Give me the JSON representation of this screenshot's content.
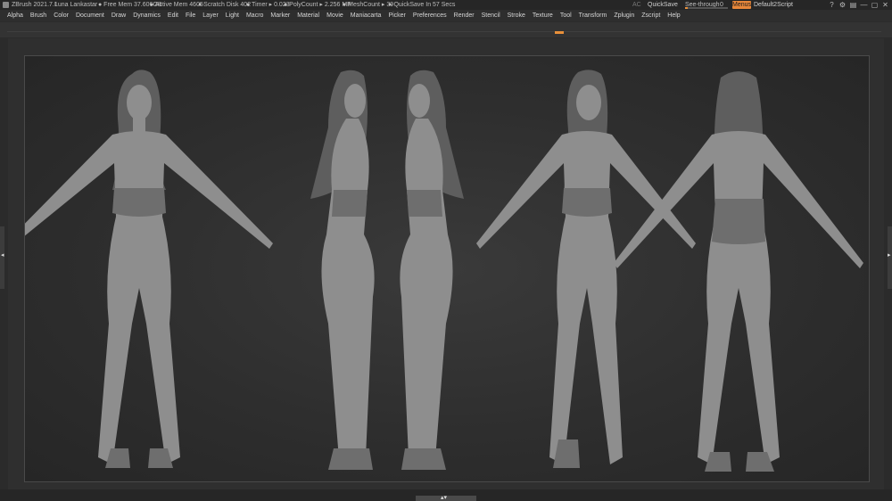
{
  "titlebar": {
    "app": "ZBrush 2021.7.1",
    "user": "Luna Lankastar",
    "free_mem": "● Free Mem 37.606GB",
    "active_mem": "● Active Mem 4605",
    "scratch": "● Scratch Disk 402",
    "timer": "● Timer ▸ 0.023",
    "polycount": "● PolyCount ▸ 2.256 MP",
    "meshcount": "● MeshCount ▸ 39",
    "quicksave_timer": "▸ QuickSave In 57 Secs",
    "ac": "AC",
    "quicksave": "QuickSave",
    "see_through_label": "See-through",
    "see_through_value": "0",
    "see_through_level": 0,
    "menus": "Menus",
    "default_script": "Default2Script"
  },
  "menu": [
    "Alpha",
    "Brush",
    "Color",
    "Document",
    "Draw",
    "Dynamics",
    "Edit",
    "File",
    "Layer",
    "Light",
    "Macro",
    "Marker",
    "Material",
    "Movie",
    "Maniacarta",
    "Picker",
    "Preferences",
    "Render",
    "Stencil",
    "Stroke",
    "Texture",
    "Tool",
    "Transform",
    "Zplugin",
    "Zscript",
    "Help"
  ],
  "icons": {
    "window_icons": [
      "help-icon",
      "settings-icon",
      "layout-icon",
      "minimize-icon",
      "maximize-icon",
      "close-icon"
    ],
    "glyphs": [
      "?",
      "⚙",
      "▤",
      "—",
      "▢",
      "✕"
    ]
  },
  "colors": {
    "accent": "#e8873a",
    "clay": "#8e8e8e",
    "background": "#2b2b2b"
  }
}
